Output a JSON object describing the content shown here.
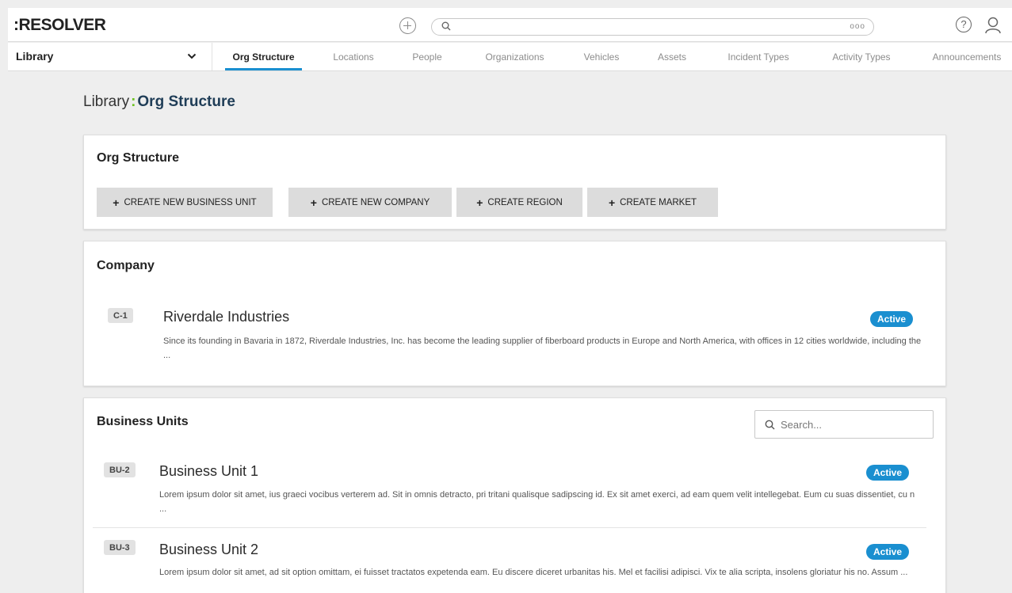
{
  "app": {
    "logo": ":RESOLVER"
  },
  "topbar": {
    "search_more": "ooo"
  },
  "nav": {
    "library_select": "Library",
    "tabs": [
      {
        "label": "Org Structure",
        "active": true
      },
      {
        "label": "Locations"
      },
      {
        "label": "People"
      },
      {
        "label": "Organizations"
      },
      {
        "label": "Vehicles"
      },
      {
        "label": "Assets"
      },
      {
        "label": "Incident Types"
      },
      {
        "label": "Activity Types"
      },
      {
        "label": "Announcements"
      }
    ]
  },
  "breadcrumb": {
    "root": "Library",
    "separator": ":",
    "current": "Org Structure"
  },
  "org_card": {
    "title": "Org Structure",
    "buttons": [
      "CREATE NEW BUSINESS UNIT",
      "CREATE NEW COMPANY",
      "CREATE REGION",
      "CREATE MARKET"
    ]
  },
  "company_card": {
    "title": "Company",
    "item": {
      "code": "C-1",
      "name": "Riverdale Industries",
      "status": "Active",
      "description": "Since its founding in Bavaria in 1872, Riverdale Industries, Inc. has become the leading supplier of fiberboard products in Europe and North America, with offices in 12 cities worldwide, including the ..."
    }
  },
  "bu_card": {
    "title": "Business Units",
    "search_placeholder": "Search...",
    "items": [
      {
        "code": "BU-2",
        "name": "Business Unit 1",
        "status": "Active",
        "description": "Lorem ipsum dolor sit amet, ius graeci vocibus verterem ad. Sit in omnis detracto, pri tritani qualisque sadipscing id. Ex sit amet exerci, ad eam quem velit intellegebat. Eum cu suas dissentiet, cu n ..."
      },
      {
        "code": "BU-3",
        "name": "Business Unit 2",
        "status": "Active",
        "description": "Lorem ipsum dolor sit amet, ad sit option omittam, ei fuisset tractatos expetenda eam. Eu discere diceret urbanitas his. Mel et facilisi adipisci. Vix te alia scripta, insolens gloriatur his no. Assum ..."
      }
    ]
  },
  "colors": {
    "accent": "#1a8fd0",
    "brand_green": "#6cc21f",
    "breadcrumb_current": "#1f3d57"
  }
}
